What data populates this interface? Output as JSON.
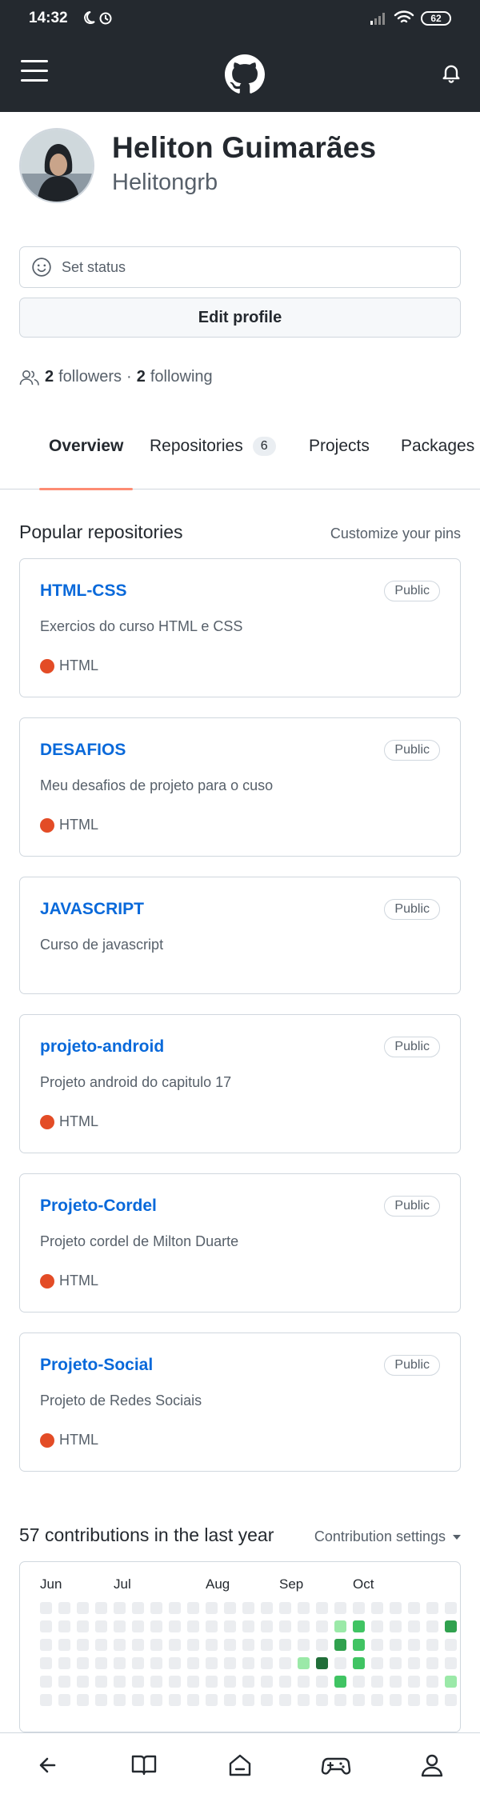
{
  "status_bar": {
    "time": "14:32",
    "battery": "62"
  },
  "profile": {
    "full_name": "Heliton Guimarães",
    "login": "Helitongrb"
  },
  "status": {
    "label": "Set status"
  },
  "edit_profile_label": "Edit profile",
  "social": {
    "followers_count": "2",
    "followers_label": "followers",
    "separator": "·",
    "following_count": "2",
    "following_label": "following"
  },
  "tabs": [
    {
      "label": "Overview",
      "active": true
    },
    {
      "label": "Repositories",
      "count": "6"
    },
    {
      "label": "Projects"
    },
    {
      "label": "Packages"
    }
  ],
  "popular": {
    "title": "Popular repositories",
    "customize_label": "Customize your pins",
    "repos": [
      {
        "name": "HTML-CSS",
        "visibility": "Public",
        "description": "Exercios do curso HTML e CSS",
        "language": "HTML"
      },
      {
        "name": "DESAFIOS",
        "visibility": "Public",
        "description": "Meu desafios de projeto para o cuso",
        "language": "HTML"
      },
      {
        "name": "JAVASCRIPT",
        "visibility": "Public",
        "description": "Curso de javascript"
      },
      {
        "name": "projeto-android",
        "visibility": "Public",
        "description": "Projeto android do capitulo 17",
        "language": "HTML"
      },
      {
        "name": "Projeto-Cordel",
        "visibility": "Public",
        "description": "Projeto cordel de Milton Duarte",
        "language": "HTML"
      },
      {
        "name": "Projeto-Social",
        "visibility": "Public",
        "description": "Projeto de Redes Sociais",
        "language": "HTML"
      }
    ],
    "language_color": "#e34c26"
  },
  "contributions": {
    "title": "57 contributions in the last year",
    "settings_label": "Contribution settings",
    "months": [
      "Jun",
      "Jul",
      "Aug",
      "Sep",
      "Oct"
    ],
    "month_weeks": [
      0,
      4,
      9,
      13,
      17
    ],
    "levels": [
      "000000",
      "000000",
      "000000",
      "000000",
      "000000",
      "000000",
      "000000",
      "000000",
      "000000",
      "000000",
      "000000",
      "000000",
      "000000",
      "000000",
      "000100",
      "000400",
      "013020",
      "022200",
      "000000",
      "000000",
      "000000",
      "000000",
      "030010",
      "400000",
      "011330"
    ],
    "colors": [
      "#ebedf0",
      "#9be9a8",
      "#40c463",
      "#30a14e",
      "#216e39"
    ]
  },
  "bottom_nav": [
    "back-icon",
    "book-icon",
    "home-icon",
    "gamepad-icon",
    "person-icon"
  ]
}
